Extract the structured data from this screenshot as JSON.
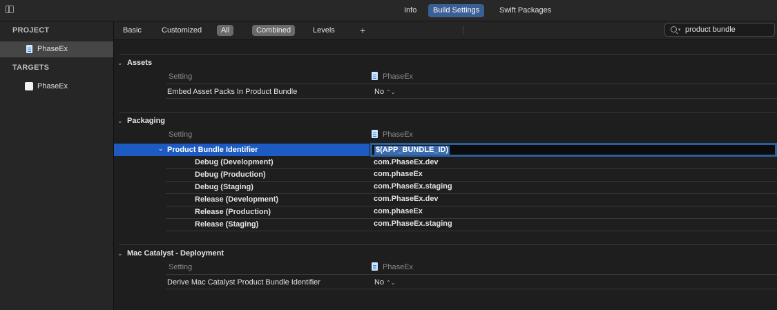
{
  "topnav": {
    "info": "Info",
    "build_settings": "Build Settings",
    "swift_packages": "Swift Packages"
  },
  "sidebar": {
    "project_header": "PROJECT",
    "project_item": "PhaseEx",
    "targets_header": "TARGETS",
    "target_item": "PhaseEx"
  },
  "filterbar": {
    "basic": "Basic",
    "customized": "Customized",
    "all": "All",
    "combined": "Combined",
    "levels": "Levels",
    "add": "+"
  },
  "search": {
    "value": "product bundle"
  },
  "sections": {
    "assets": {
      "title": "Assets",
      "setting_header": "Setting",
      "project_col": "PhaseEx",
      "row_label": "Embed Asset Packs In Product Bundle",
      "row_value": "No"
    },
    "packaging": {
      "title": "Packaging",
      "setting_header": "Setting",
      "project_col": "PhaseEx",
      "selected_label": "Product Bundle Identifier",
      "selected_value": "$(APP_BUNDLE_ID)",
      "rows": [
        {
          "label": "Debug (Development)",
          "value": "com.PhaseEx.dev"
        },
        {
          "label": "Debug (Production)",
          "value": "com.phaseEx"
        },
        {
          "label": "Debug (Staging)",
          "value": "com.PhaseEx.staging"
        },
        {
          "label": "Release (Development)",
          "value": "com.PhaseEx.dev"
        },
        {
          "label": "Release (Production)",
          "value": "com.phaseEx"
        },
        {
          "label": "Release (Staging)",
          "value": "com.PhaseEx.staging"
        }
      ]
    },
    "catalyst": {
      "title": "Mac Catalyst - Deployment",
      "setting_header": "Setting",
      "project_col": "PhaseEx",
      "row_label": "Derive Mac Catalyst Product Bundle Identifier",
      "row_value": "No"
    }
  },
  "colors": {
    "accent": "#1d5bc2",
    "tab_selected": "#3a5f94",
    "background": "#1e1e1e"
  },
  "icons": {
    "sidebar_toggle": "sidebar-toggle-icon",
    "project_file": "project-file-icon",
    "target": "target-app-icon",
    "search": "search-icon",
    "disclosure": "disclosure-chevron-icon",
    "popup": "popup-arrows-icon"
  }
}
